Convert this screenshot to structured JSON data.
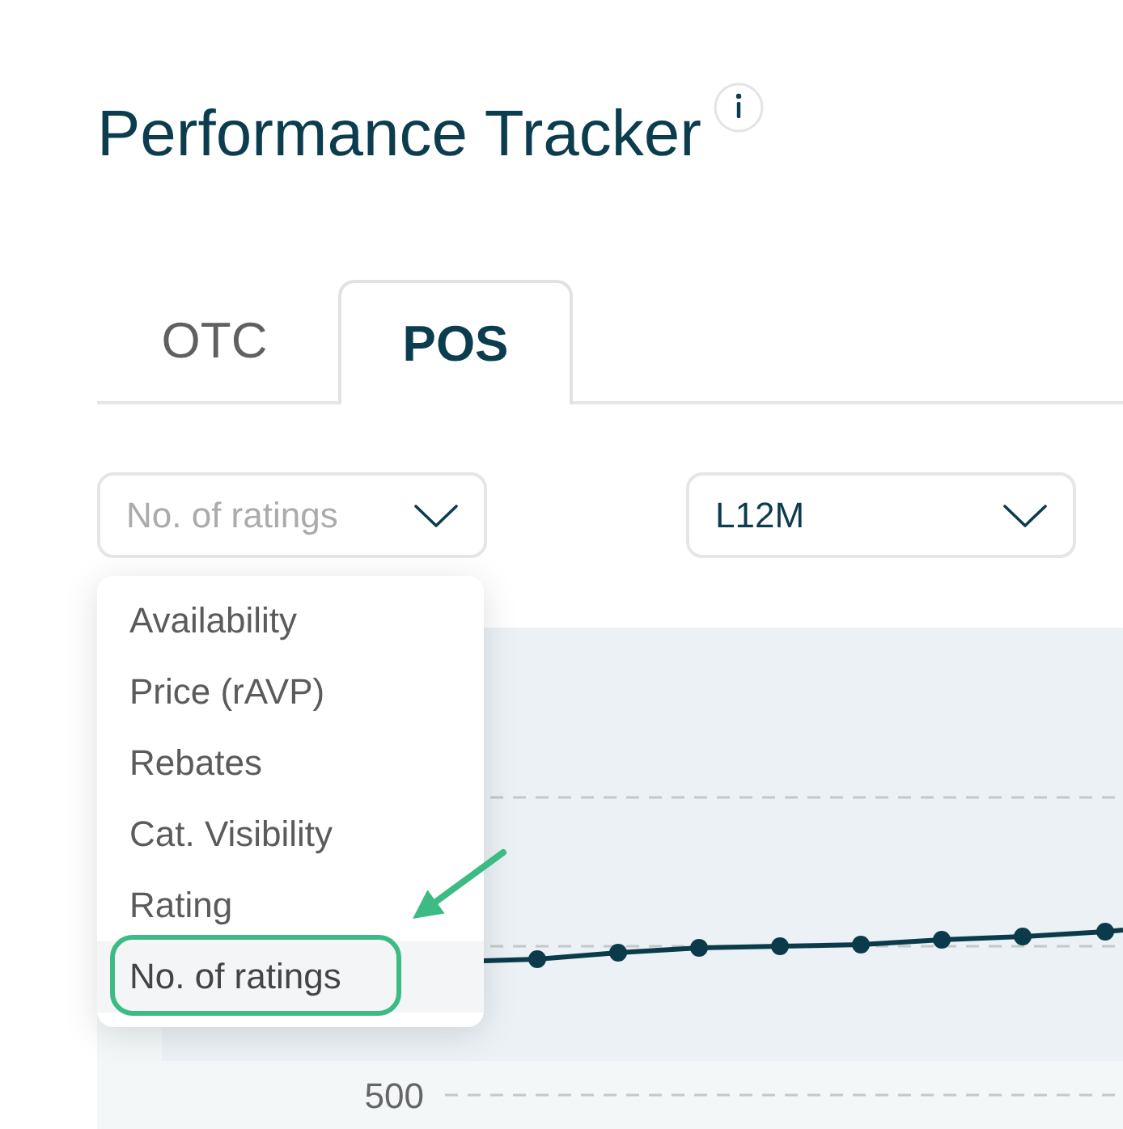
{
  "page": {
    "title": "Performance Tracker"
  },
  "tabs": [
    {
      "label": "OTC",
      "selected": false
    },
    {
      "label": "POS",
      "selected": true
    }
  ],
  "filters": [
    {
      "kind": "select",
      "placeholder": "No. of ratings",
      "menu": [
        {
          "label": "Availability",
          "selected": false,
          "callout": false
        },
        {
          "label": "Price (rAVP)",
          "selected": false,
          "callout": false
        },
        {
          "label": "Rebates",
          "selected": false,
          "callout": false
        },
        {
          "label": "Cat. Visibility",
          "selected": false,
          "callout": false
        },
        {
          "label": "Rating",
          "selected": false,
          "callout": false
        },
        {
          "label": "No. of ratings",
          "selected": true,
          "callout": true
        }
      ]
    },
    {
      "kind": "select",
      "value": "L12M"
    }
  ],
  "chart": {
    "y_axis_labels": [
      "500"
    ]
  }
}
